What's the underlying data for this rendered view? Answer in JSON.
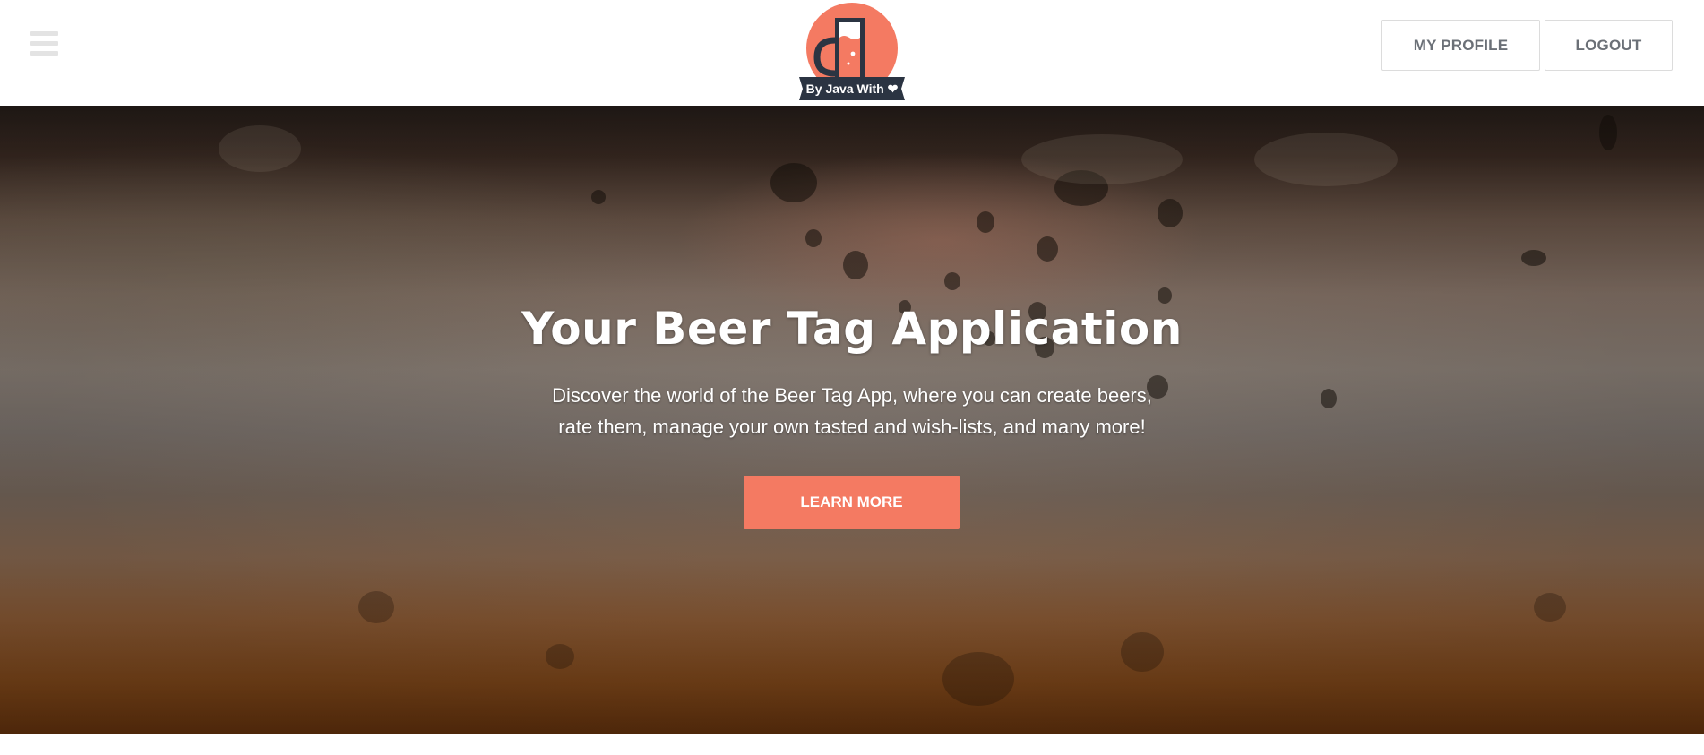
{
  "header": {
    "menu_icon": "hamburger-menu-icon",
    "logo": {
      "icon": "beer-mug-icon",
      "tagline": "By Java With ❤"
    },
    "nav": {
      "my_profile": "MY PROFILE",
      "logout": "LOGOUT"
    }
  },
  "hero": {
    "title": "Your Beer Tag Application",
    "subtitle_line1": "Discover the world of the Beer Tag App, where you can create beers,",
    "subtitle_line2": "rate them, manage your own tasted and wish-lists, and many more!",
    "cta_label": "LEARN MORE"
  },
  "colors": {
    "accent": "#f47a62",
    "logo_dark": "#2b3442",
    "nav_text": "#6b7077",
    "nav_border": "#dcdcdc"
  }
}
